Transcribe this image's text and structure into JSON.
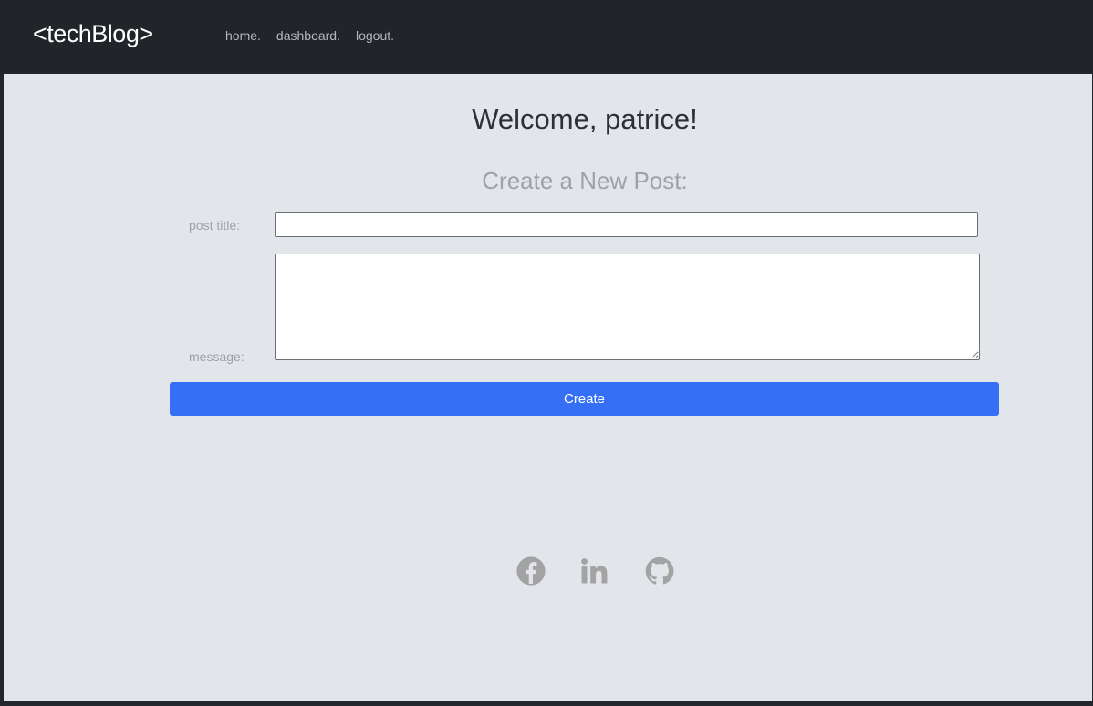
{
  "nav": {
    "brand": "<techBlog>",
    "links": [
      "home.",
      "dashboard.",
      "logout."
    ]
  },
  "main": {
    "welcome": "Welcome, patrice!",
    "create_heading": "Create a New Post:",
    "form": {
      "title_label": "post title:",
      "title_value": "",
      "message_label": "message:",
      "message_value": "",
      "submit_label": "Create"
    }
  },
  "footer": {
    "icons": [
      "facebook-icon",
      "linkedin-icon",
      "github-icon"
    ]
  },
  "colors": {
    "navbar": "#212429",
    "page_background": "#e2e6eb",
    "button": "#346ff5",
    "icon": "#a3a3a3"
  }
}
